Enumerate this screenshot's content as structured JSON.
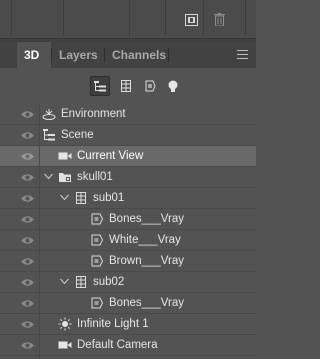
{
  "panel": {
    "tabs": [
      {
        "label": "3D"
      },
      {
        "label": "Layers"
      },
      {
        "label": "Channels"
      }
    ],
    "top_icons": [
      "new-layer-icon",
      "trash-icon"
    ],
    "menu_icon": "panel-menu-icon"
  },
  "filters": [
    {
      "icon": "whole-scene-icon",
      "active": true
    },
    {
      "icon": "meshes-icon",
      "active": false
    },
    {
      "icon": "materials-icon",
      "active": false
    },
    {
      "icon": "lights-icon",
      "active": false
    }
  ],
  "tree": [
    {
      "label": "Environment",
      "icon": "environment-icon",
      "depth": 0
    },
    {
      "label": "Scene",
      "icon": "scene-icon",
      "depth": 0
    },
    {
      "label": "Current View",
      "icon": "camera-icon",
      "depth": 1,
      "selected": true
    },
    {
      "label": "skull01",
      "icon": "folder-icon",
      "depth": 0,
      "expanded": true
    },
    {
      "label": "sub01",
      "icon": "mesh-icon",
      "depth": 1,
      "expanded": true
    },
    {
      "label": "Bones___Vray",
      "icon": "material-icon",
      "depth": 2
    },
    {
      "label": "White___Vray",
      "icon": "material-icon",
      "depth": 2
    },
    {
      "label": "Brown___Vray",
      "icon": "material-icon",
      "depth": 2
    },
    {
      "label": "sub02",
      "icon": "mesh-icon",
      "depth": 1,
      "expanded": true
    },
    {
      "label": "Bones___Vray",
      "icon": "material-icon",
      "depth": 2
    },
    {
      "label": "Infinite Light 1",
      "icon": "infinite-light-icon",
      "depth": 0
    },
    {
      "label": "Default Camera",
      "icon": "camera-icon",
      "depth": 0
    }
  ],
  "colors": {
    "panel_bg": "#535353",
    "tab_bar_bg": "#424242",
    "selected_row": "#6a6a6a",
    "text": "#e6e6e6"
  }
}
